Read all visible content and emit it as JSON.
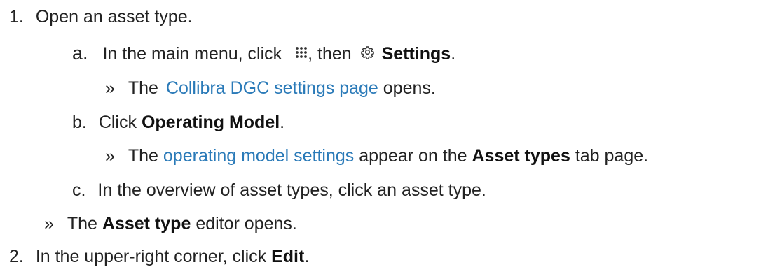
{
  "steps": [
    {
      "marker": "1.",
      "text": "Open an asset type.",
      "substeps": [
        {
          "marker": "a.",
          "text_before": "In the main menu, click",
          "icon_1": "grid-dots-icon",
          "text_middle": ", then",
          "icon_2": "gear-icon",
          "bold": "Settings",
          "text_after": ".",
          "result": {
            "marker": "»",
            "text_before": "The",
            "link": "Collibra DGC settings page",
            "text_after": "opens."
          }
        },
        {
          "marker": "b.",
          "text_before": "Click",
          "bold": "Operating Model",
          "text_after": ".",
          "result": {
            "marker": "»",
            "text_before": "The",
            "link": "operating model settings",
            "text_middle": "appear on the",
            "bold": "Asset types",
            "text_after": "tab page."
          }
        },
        {
          "marker": "c.",
          "text": "In the overview of asset types, click an asset type."
        }
      ],
      "result": {
        "marker": "»",
        "text_before": "The",
        "bold": "Asset type",
        "text_after": "editor opens."
      }
    },
    {
      "marker": "2.",
      "text_before": "In the upper-right corner, click",
      "bold": "Edit",
      "text_after": "."
    }
  ],
  "colors": {
    "text": "#222222",
    "link": "#2a7ab8"
  }
}
